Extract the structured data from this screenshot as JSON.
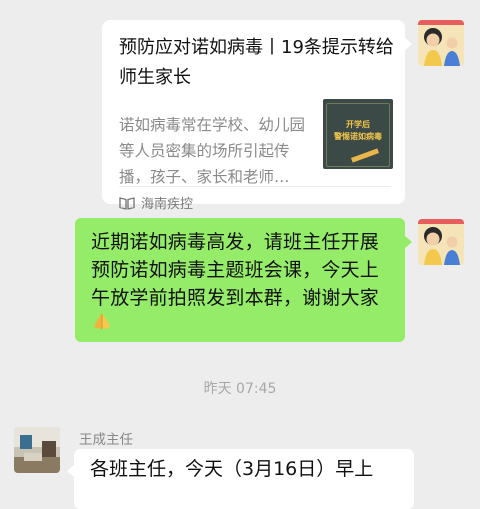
{
  "shared_card": {
    "title": "预防应对诺如病毒丨19条提示转给师生家长",
    "description": "诺如病毒常在学校、幼儿园等人员密集的场所引起传播，孩子、家长和老师…",
    "thumbnail_lines": [
      "开学后",
      "警惕诺如病毒"
    ],
    "source": "海南疾控",
    "source_icon": "book-icon"
  },
  "sent_message": {
    "text": "近期诺如病毒高发，请班主任开展预防诺如病毒主题班会课，今天上午放学前拍照发到本群，谢谢大家",
    "emoji": "praying-hands"
  },
  "timestamp": "昨天 07:45",
  "received_message": {
    "sender": "王成主任",
    "text": "各班主任，今天（3月16日）早上"
  },
  "colors": {
    "background": "#ededed",
    "sent_bubble": "#95ec69",
    "received_bubble": "#ffffff"
  }
}
